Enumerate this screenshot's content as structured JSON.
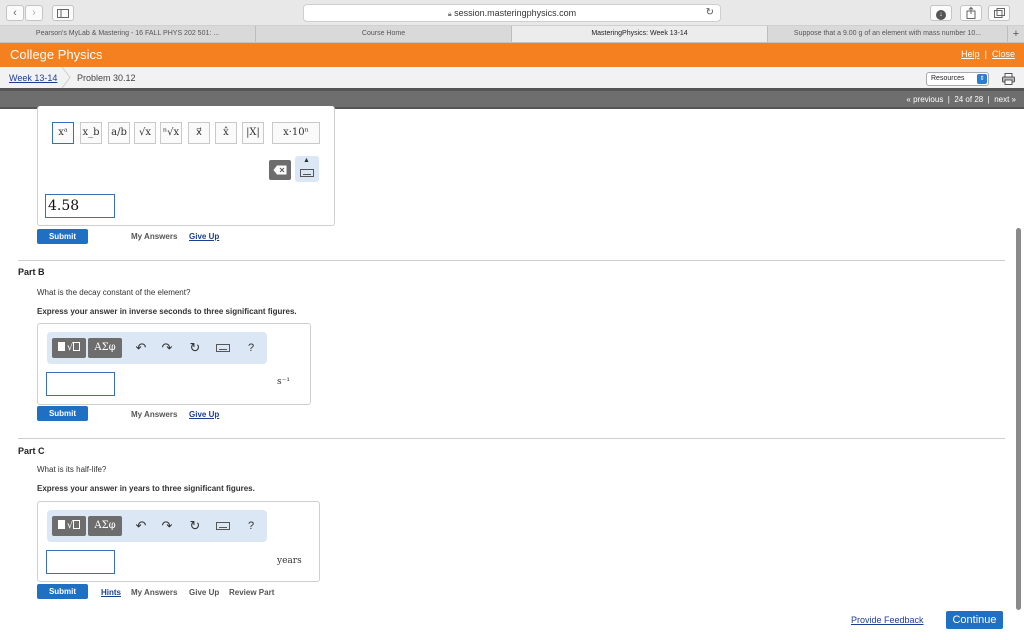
{
  "browser": {
    "address": "session.masteringphysics.com",
    "tabs": [
      {
        "label": "Pearson's MyLab & Mastering - 16 FALL PHYS 202 501: ...",
        "active": false
      },
      {
        "label": "Course Home",
        "active": false
      },
      {
        "label": "MasteringPhysics: Week 13-14",
        "active": true
      },
      {
        "label": "Suppose that a 9.00 g of an element with mass number 10...",
        "active": false
      }
    ]
  },
  "header": {
    "title": "College Physics",
    "help": "Help",
    "separator": "|",
    "close": "Close"
  },
  "breadcrumb": {
    "week": "Week 13-14",
    "problem": "Problem 30.12",
    "resources": "Resources"
  },
  "nav": {
    "previous": "« previous",
    "position": "24 of 28",
    "next": "next »"
  },
  "partA": {
    "templates": [
      "xᵃ",
      "x_b",
      "a/b",
      "√x",
      "ⁿ√x",
      "x⃗",
      "x̂",
      "|X|",
      "x·10ⁿ"
    ],
    "answer": "4.58",
    "submit": "Submit",
    "my_answers": "My Answers",
    "give_up": "Give Up"
  },
  "partB": {
    "label": "Part B",
    "question": "What is the decay constant of the element?",
    "instruction": "Express your answer in inverse seconds to three significant figures.",
    "answer": "",
    "unit": "s⁻¹",
    "submit": "Submit",
    "my_answers": "My Answers",
    "give_up": "Give Up"
  },
  "partC": {
    "label": "Part C",
    "question": "What is its half-life?",
    "instruction": "Express your answer in years to three significant figures.",
    "answer": "",
    "unit": "years",
    "submit": "Submit",
    "hints": "Hints",
    "my_answers": "My Answers",
    "give_up": "Give Up",
    "review_part": "Review Part"
  },
  "mathbar": {
    "greek": "ΑΣφ",
    "help": "?"
  },
  "footer": {
    "feedback": "Provide Feedback",
    "continue": "Continue"
  }
}
